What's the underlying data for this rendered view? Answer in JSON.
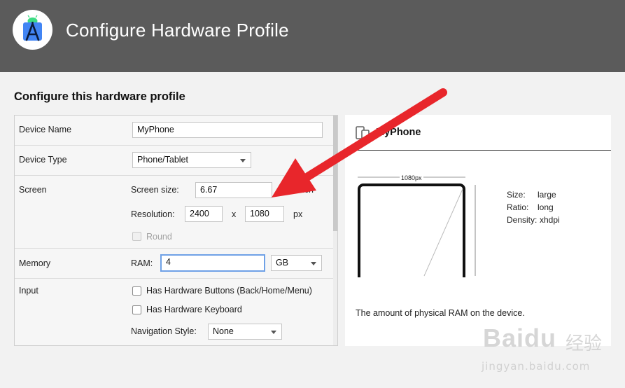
{
  "window": {
    "title": "Configure Hardware Profile"
  },
  "section_title": "Configure this hardware profile",
  "form": {
    "device_name": {
      "label": "Device Name",
      "value": "MyPhone"
    },
    "device_type": {
      "label": "Device Type",
      "value": "Phone/Tablet"
    },
    "screen": {
      "label": "Screen",
      "size_label": "Screen size:",
      "size_value": "6.67",
      "size_unit": "inch",
      "resolution_label": "Resolution:",
      "res_w": "2400",
      "res_x": "x",
      "res_h": "1080",
      "res_unit": "px",
      "round_label": "Round"
    },
    "memory": {
      "label": "Memory",
      "ram_label": "RAM:",
      "ram_value": "4",
      "ram_unit": "GB"
    },
    "input": {
      "label": "Input",
      "hw_buttons_label": "Has Hardware Buttons (Back/Home/Menu)",
      "hw_keyboard_label": "Has Hardware Keyboard",
      "nav_style_label": "Navigation Style:",
      "nav_style_value": "None"
    }
  },
  "preview": {
    "name": "MyPhone",
    "width_label": "1080px",
    "size_label": "Size:",
    "size_value": "large",
    "ratio_label": "Ratio:",
    "ratio_value": "long",
    "density_label": "Density:",
    "density_value": "xhdpi",
    "description": "The amount of physical RAM on the device."
  },
  "watermark": {
    "brand": "Baidu",
    "brand_cn": "经验",
    "url": "jingyan.baidu.com"
  },
  "colors": {
    "header_bg": "#5b5b5b",
    "arrow": "#e8262b",
    "focus_border": "#6fa1e6",
    "android_green": "#3ddc84",
    "studio_blue": "#4285f4"
  }
}
